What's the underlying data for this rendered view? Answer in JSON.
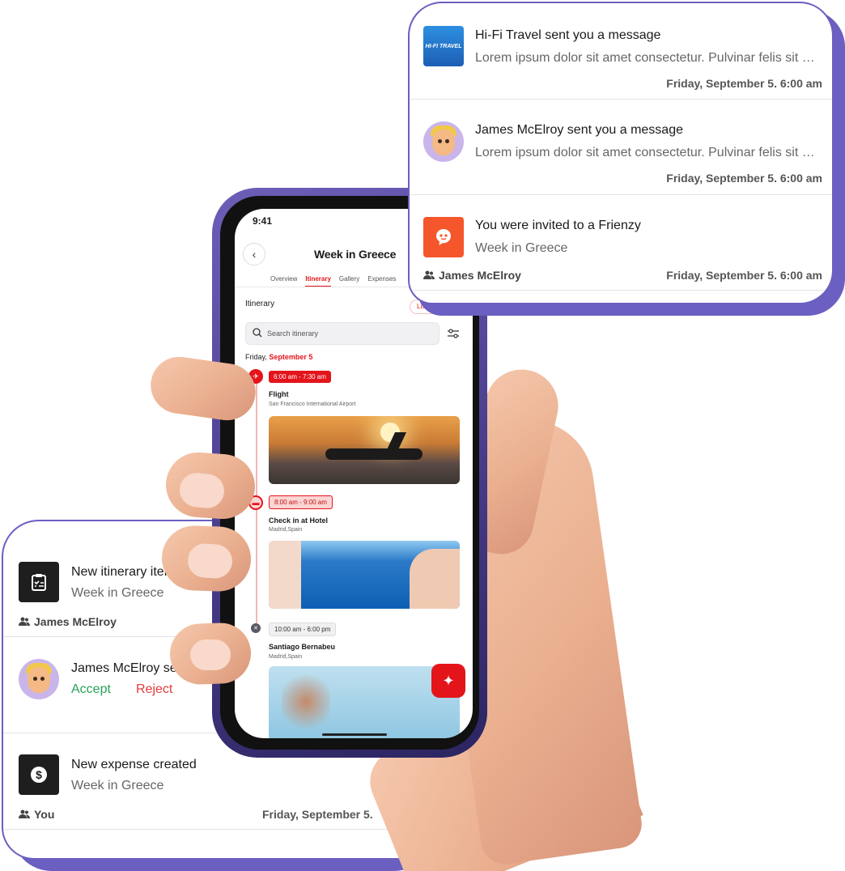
{
  "phone": {
    "status_time": "9:41",
    "back_label": "‹",
    "title": "Week in Greece",
    "tabs": [
      "Overview",
      "Itinerary",
      "Gallery",
      "Expenses"
    ],
    "active_tab": "Itinerary",
    "section_label": "Itinerary",
    "view_chip": "List",
    "search_placeholder": "Search itinerary",
    "date_prefix": "Friday,",
    "date_highlight": "September 5",
    "items": [
      {
        "time": "6:00 am - 7:30 am",
        "title": "Flight",
        "subtitle": "San Francisco International Airport"
      },
      {
        "time": "8:00 am - 9:00 am",
        "title": "Check in at Hotel",
        "subtitle": "Madrid,Spain"
      },
      {
        "time": "10:00 am - 6:00 pm",
        "title": "Santiago Bernabeu",
        "subtitle": "Madrid,Spain"
      }
    ],
    "fab_icon": "sparkle-icon"
  },
  "top_card": {
    "notifications": [
      {
        "icon": "hifi-travel-logo",
        "logo_text": "HI-FI TRAVEL",
        "title": "Hi-Fi Travel sent you a message",
        "body": "Lorem ipsum dolor sit amet consectetur. Pulvinar felis sit eget...",
        "time": "Friday, September 5. 6:00 am"
      },
      {
        "icon": "user-avatar",
        "title": "James McElroy sent you a message",
        "body": "Lorem ipsum dolor sit amet consectetur. Pulvinar felis sit eget...",
        "time": "Friday, September 5. 6:00 am"
      },
      {
        "icon": "frienzy-logo",
        "title": "You were invited to a Frienzy",
        "body": "Week in Greece",
        "user": "James McElroy",
        "time": "Friday, September 5. 6:00 am"
      }
    ]
  },
  "bottom_card": {
    "notifications": [
      {
        "icon": "clipboard-icon",
        "title": "New itinerary item",
        "body": "Week in Greece",
        "user": "James McElroy"
      },
      {
        "icon": "user-avatar",
        "title": "James McElroy sent",
        "accept_label": "Accept",
        "reject_label": "Reject"
      },
      {
        "icon": "dollar-icon",
        "title": "New expense created",
        "body": "Week in Greece",
        "user": "You",
        "time": "Friday, September 5."
      }
    ]
  },
  "colors": {
    "accent_red": "#e4141b",
    "card_border": "#6b5fc1",
    "accept_green": "#27a35a",
    "reject_red": "#e23b3b"
  }
}
